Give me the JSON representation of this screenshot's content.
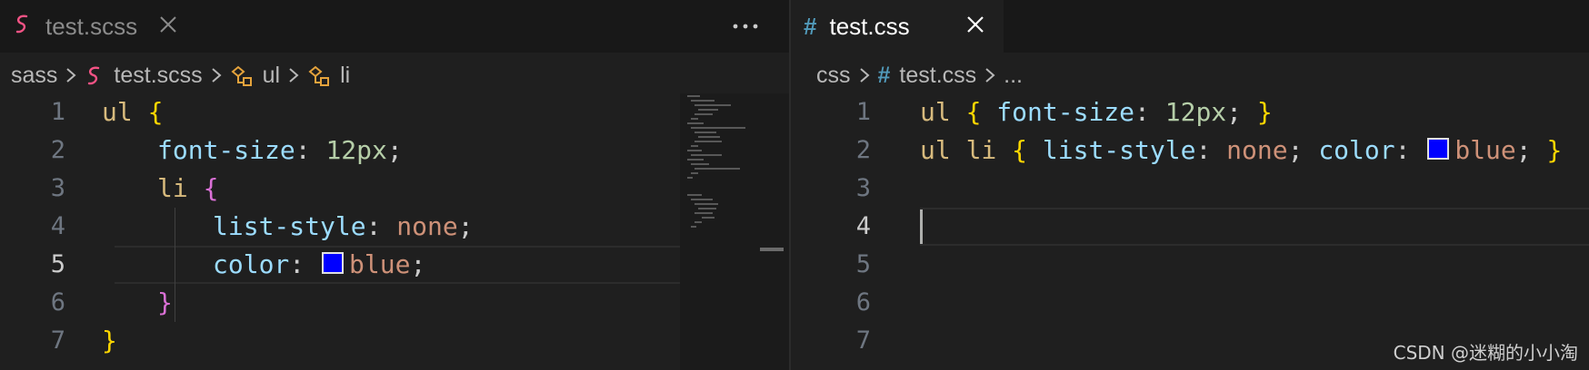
{
  "left_tabs": [
    {
      "label": "test.scss",
      "active": false
    }
  ],
  "right_tabs": [
    {
      "label": "test.css",
      "active": true
    }
  ],
  "left_breadcrumb": {
    "folder": "sass",
    "file": "test.scss",
    "sym1": "ul",
    "sym2": "li"
  },
  "right_breadcrumb": {
    "folder": "css",
    "file": "test.css",
    "ellipsis": "..."
  },
  "left_editor": {
    "line_numbers": [
      "1",
      "2",
      "3",
      "4",
      "5",
      "6",
      "7"
    ],
    "current_line": 5,
    "lines": [
      [
        {
          "t": "ul ",
          "c": "sel"
        },
        {
          "t": "{",
          "c": "brace1"
        }
      ],
      [
        {
          "t": "font-size",
          "c": "prop"
        },
        {
          "t": ": ",
          "c": "punc"
        },
        {
          "t": "12px",
          "c": "num"
        },
        {
          "t": ";",
          "c": "punc"
        }
      ],
      [
        {
          "t": "li ",
          "c": "sel"
        },
        {
          "t": "{",
          "c": "brace2"
        }
      ],
      [
        {
          "t": "list-style",
          "c": "prop"
        },
        {
          "t": ": ",
          "c": "punc"
        },
        {
          "t": "none",
          "c": "val"
        },
        {
          "t": ";",
          "c": "punc"
        }
      ],
      [
        {
          "t": "color",
          "c": "prop"
        },
        {
          "t": ": ",
          "c": "punc"
        },
        {
          "t": "",
          "c": "swatch"
        },
        {
          "t": "blue",
          "c": "val"
        },
        {
          "t": ";",
          "c": "punc"
        }
      ],
      [
        {
          "t": "}",
          "c": "brace2"
        }
      ],
      [
        {
          "t": "}",
          "c": "brace1"
        }
      ]
    ]
  },
  "right_editor": {
    "line_numbers": [
      "1",
      "2",
      "3",
      "4",
      "5",
      "6",
      "7"
    ],
    "current_line": 4,
    "lines": [
      [
        {
          "t": "ul ",
          "c": "sel"
        },
        {
          "t": "{ ",
          "c": "brace1"
        },
        {
          "t": "font-size",
          "c": "prop"
        },
        {
          "t": ": ",
          "c": "punc"
        },
        {
          "t": "12px",
          "c": "num"
        },
        {
          "t": "; ",
          "c": "punc"
        },
        {
          "t": "}",
          "c": "brace1"
        }
      ],
      [
        {
          "t": "ul li ",
          "c": "sel"
        },
        {
          "t": "{ ",
          "c": "brace1"
        },
        {
          "t": "list-style",
          "c": "prop"
        },
        {
          "t": ": ",
          "c": "punc"
        },
        {
          "t": "none",
          "c": "val"
        },
        {
          "t": "; ",
          "c": "punc"
        },
        {
          "t": "color",
          "c": "prop"
        },
        {
          "t": ": ",
          "c": "punc"
        },
        {
          "t": "",
          "c": "swatch"
        },
        {
          "t": "blue",
          "c": "val"
        },
        {
          "t": "; ",
          "c": "punc"
        },
        {
          "t": "}",
          "c": "brace1"
        }
      ],
      [],
      [],
      [],
      [],
      []
    ]
  },
  "colors": {
    "selector": "#d7ba7d",
    "property": "#9cdcfe",
    "number": "#b5cea8",
    "value": "#ce9178",
    "brace_outer": "#ffd700",
    "brace_inner": "#da70d6",
    "swatch": "#0000ff",
    "scss_icon": "#f55385",
    "css_icon": "#519aba",
    "symbol_icon": "#e5a33c"
  },
  "watermark": "CSDN @迷糊的小小淘"
}
